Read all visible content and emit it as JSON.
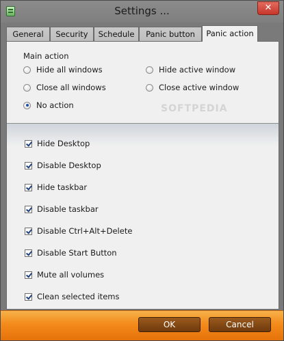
{
  "window": {
    "title": "Settings ...",
    "close_glyph": "✕"
  },
  "tabs": [
    {
      "label": "General"
    },
    {
      "label": "Security"
    },
    {
      "label": "Schedule"
    },
    {
      "label": "Panic button"
    },
    {
      "label": "Panic action",
      "active": true
    }
  ],
  "main_action": {
    "label": "Main action",
    "selected": "No action",
    "options": [
      {
        "label": "Hide all windows",
        "selected": false
      },
      {
        "label": "Hide active window",
        "selected": false
      },
      {
        "label": "Close all windows",
        "selected": false
      },
      {
        "label": "Close active window",
        "selected": false
      },
      {
        "label": "No action",
        "selected": true
      }
    ]
  },
  "options": [
    {
      "label": "Hide Desktop",
      "checked": true
    },
    {
      "label": "Disable Desktop",
      "checked": true
    },
    {
      "label": "Hide taskbar",
      "checked": true
    },
    {
      "label": "Disable taskbar",
      "checked": true
    },
    {
      "label": "Disable Ctrl+Alt+Delete",
      "checked": true
    },
    {
      "label": "Disable Start Button",
      "checked": true
    },
    {
      "label": "Mute all volumes",
      "checked": true
    },
    {
      "label": "Clean selected items",
      "checked": true
    }
  ],
  "buttons": {
    "ok": "OK",
    "cancel": "Cancel"
  },
  "colors": {
    "footer": "#f48a1a",
    "button": "#6e3a0d",
    "close": "#c7362a"
  },
  "watermark": "SOFTPEDIA"
}
